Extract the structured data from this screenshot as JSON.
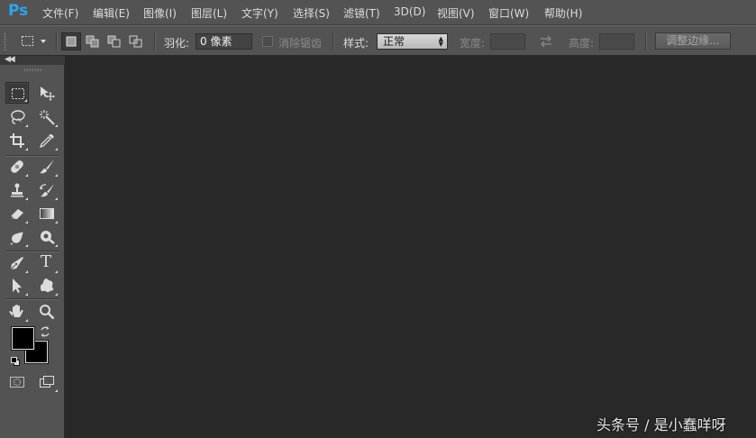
{
  "app": {
    "logo": "Ps"
  },
  "menu": [
    "文件(F)",
    "编辑(E)",
    "图像(I)",
    "图层(L)",
    "文字(Y)",
    "选择(S)",
    "滤镜(T)",
    "3D(D)",
    "视图(V)",
    "窗口(W)",
    "帮助(H)"
  ],
  "options": {
    "feather_label": "羽化:",
    "feather_value": "0 像素",
    "antialias_label": "消除锯齿",
    "style_label": "样式:",
    "style_value": "正常",
    "width_label": "宽度:",
    "height_label": "高度:",
    "refine_edge_label": "调整边缘..."
  },
  "toolbox": {
    "tools": [
      "rectangular-marquee",
      "move",
      "lasso",
      "magic-wand",
      "crop",
      "eyedropper",
      "spot-healing-brush",
      "brush",
      "clone-stamp",
      "history-brush",
      "eraser",
      "gradient",
      "blur",
      "dodge",
      "pen",
      "type",
      "path-selection",
      "custom-shape",
      "hand",
      "zoom"
    ],
    "type_tool_glyph": "T",
    "foreground_color": "#000000",
    "background_color": "#000000"
  },
  "colors": {
    "chrome": "#535353",
    "workspace": "#282828",
    "logo": "#2ea3f2"
  },
  "watermark": "头条号 / 是小蠢咩呀"
}
